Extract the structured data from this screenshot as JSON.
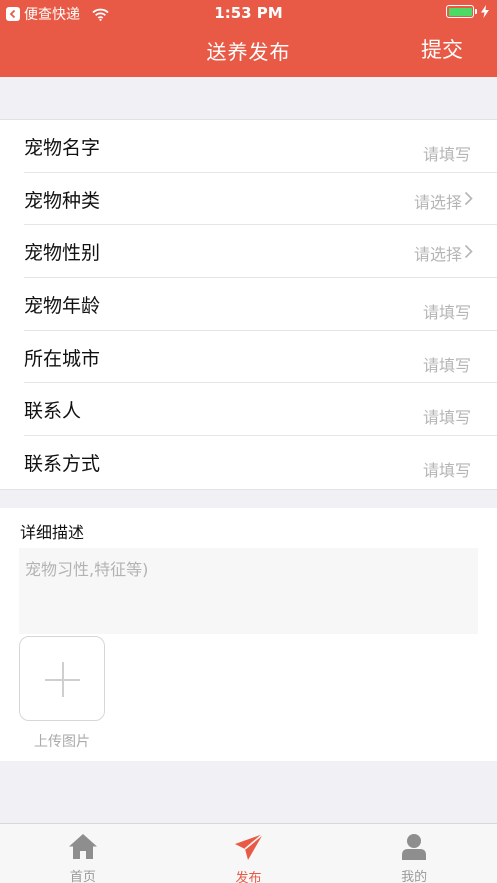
{
  "status_bar": {
    "back_app": "便查快递",
    "time": "1:53 PM"
  },
  "nav": {
    "title": "送养发布",
    "submit_label": "提交"
  },
  "form": {
    "rows": [
      {
        "label": "宠物名字",
        "value": "请填写",
        "kind": "fill"
      },
      {
        "label": "宠物种类",
        "value": "请选择",
        "kind": "select"
      },
      {
        "label": "宠物性别",
        "value": "请选择",
        "kind": "select"
      },
      {
        "label": "宠物年龄",
        "value": "请填写",
        "kind": "fill"
      },
      {
        "label": "所在城市",
        "value": "请填写",
        "kind": "fill"
      },
      {
        "label": "联系人",
        "value": "请填写",
        "kind": "fill"
      },
      {
        "label": "联系方式",
        "value": "请填写",
        "kind": "fill"
      }
    ]
  },
  "description": {
    "title": "详细描述",
    "placeholder": "宠物习性,特征等)",
    "value": ""
  },
  "upload": {
    "label": "上传图片"
  },
  "tabbar": {
    "items": [
      {
        "label": "首页",
        "icon": "home-icon",
        "active": false
      },
      {
        "label": "发布",
        "icon": "paper-plane-icon",
        "active": true
      },
      {
        "label": "我的",
        "icon": "user-icon",
        "active": false
      }
    ]
  },
  "colors": {
    "accent": "#e85a45",
    "placeholder": "#b5b5b5",
    "battery": "#4cd964"
  }
}
